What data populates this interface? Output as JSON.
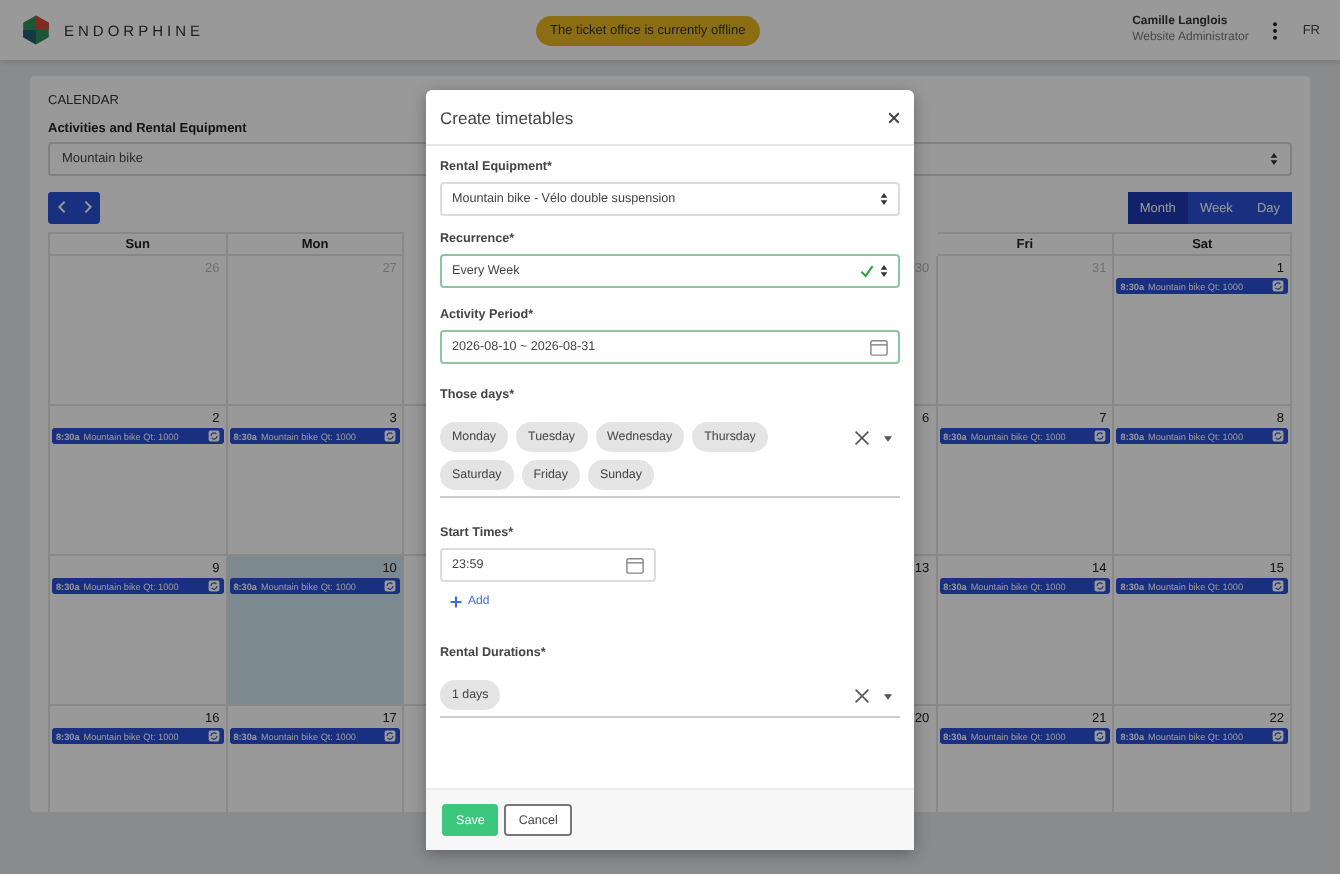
{
  "header": {
    "brand": "ENDORPHINE",
    "notice": "The ticket office is currently offline",
    "user": {
      "name": "Camille Langlois",
      "role": "Website Administrator"
    },
    "language": "FR"
  },
  "calendar": {
    "title": "CALENDAR",
    "filter_label": "Activities and Rental Equipment",
    "filter_value": "Mountain bike",
    "views": [
      {
        "label": "Month",
        "selected": true
      },
      {
        "label": "Week",
        "selected": false
      },
      {
        "label": "Day",
        "selected": false
      }
    ],
    "weekdays_left": [
      "Sun",
      "Mon"
    ],
    "weekdays_right": [
      "Fri",
      "Sat"
    ],
    "weeks": [
      {
        "left": [
          {
            "day": "26",
            "other_month": true,
            "today": false
          },
          {
            "day": "27",
            "other_month": true,
            "today": false
          }
        ],
        "right": [
          {
            "day": "30",
            "other_month": true,
            "today": false
          },
          {
            "day": "31",
            "other_month": true,
            "today": false
          },
          {
            "day": "1",
            "other_month": false,
            "today": false,
            "events": [
              {
                "time": "8:30a",
                "title": "Mountain bike Qt: 1000"
              }
            ]
          }
        ]
      },
      {
        "left": [
          {
            "day": "2",
            "other_month": false,
            "today": false,
            "events": [
              {
                "time": "8:30a",
                "title": "Mountain bike Qt: 1000"
              }
            ]
          },
          {
            "day": "3",
            "other_month": false,
            "today": false,
            "events": [
              {
                "time": "8:30a",
                "title": "Mountain bike Qt: 1000"
              }
            ]
          }
        ],
        "right": [
          {
            "day": "6",
            "other_month": false,
            "today": false
          },
          {
            "day": "7",
            "other_month": false,
            "today": false,
            "events": [
              {
                "time": "8:30a",
                "title": "Mountain bike Qt: 1000"
              }
            ]
          },
          {
            "day": "8",
            "other_month": false,
            "today": false,
            "events": [
              {
                "time": "8:30a",
                "title": "Mountain bike Qt: 1000"
              }
            ]
          }
        ]
      },
      {
        "left": [
          {
            "day": "9",
            "other_month": false,
            "today": false,
            "events": [
              {
                "time": "8:30a",
                "title": "Mountain bike Qt: 1000"
              }
            ]
          },
          {
            "day": "10",
            "other_month": false,
            "today": true,
            "events": [
              {
                "time": "8:30a",
                "title": "Mountain bike Qt: 1000"
              }
            ]
          }
        ],
        "right": [
          {
            "day": "13",
            "other_month": false,
            "today": false
          },
          {
            "day": "14",
            "other_month": false,
            "today": false,
            "events": [
              {
                "time": "8:30a",
                "title": "Mountain bike Qt: 1000"
              }
            ]
          },
          {
            "day": "15",
            "other_month": false,
            "today": false,
            "events": [
              {
                "time": "8:30a",
                "title": "Mountain bike Qt: 1000"
              }
            ]
          }
        ]
      },
      {
        "left": [
          {
            "day": "16",
            "other_month": false,
            "today": false,
            "events": [
              {
                "time": "8:30a",
                "title": "Mountain bike Qt: 1000"
              }
            ]
          },
          {
            "day": "17",
            "other_month": false,
            "today": false,
            "events": [
              {
                "time": "8:30a",
                "title": "Mountain bike Qt: 1000"
              }
            ]
          }
        ],
        "right": [
          {
            "day": "20",
            "other_month": false,
            "today": false
          },
          {
            "day": "21",
            "other_month": false,
            "today": false,
            "events": [
              {
                "time": "8:30a",
                "title": "Mountain bike Qt: 1000"
              }
            ]
          },
          {
            "day": "22",
            "other_month": false,
            "today": false,
            "events": [
              {
                "time": "8:30a",
                "title": "Mountain bike Qt: 1000"
              }
            ]
          }
        ]
      }
    ]
  },
  "modal": {
    "title": "Create timetables",
    "fields": [
      {
        "kind": "select",
        "label": "Rental Equipment*",
        "value": "Mountain bike - Vélo double suspension",
        "valid": false
      },
      {
        "kind": "select",
        "label": "Recurrence*",
        "value": "Every Week",
        "valid": true
      },
      {
        "kind": "date",
        "label": "Activity Period*",
        "value": "2026-08-10 ~ 2026-08-31",
        "valid": true
      },
      {
        "kind": "tags",
        "label": "Those days*",
        "tags": [
          "Monday",
          "Tuesday",
          "Wednesday",
          "Thursday",
          "Saturday",
          "Friday",
          "Sunday"
        ]
      },
      {
        "kind": "time",
        "label": "Start Times*",
        "value": "23:59",
        "add_label": "Add"
      },
      {
        "kind": "tags",
        "label": "Rental Durations*",
        "tags": [
          "1 days"
        ]
      }
    ],
    "buttons": [
      {
        "label": "Save",
        "kind": "primary"
      },
      {
        "label": "Cancel",
        "kind": "secondary"
      }
    ]
  }
}
